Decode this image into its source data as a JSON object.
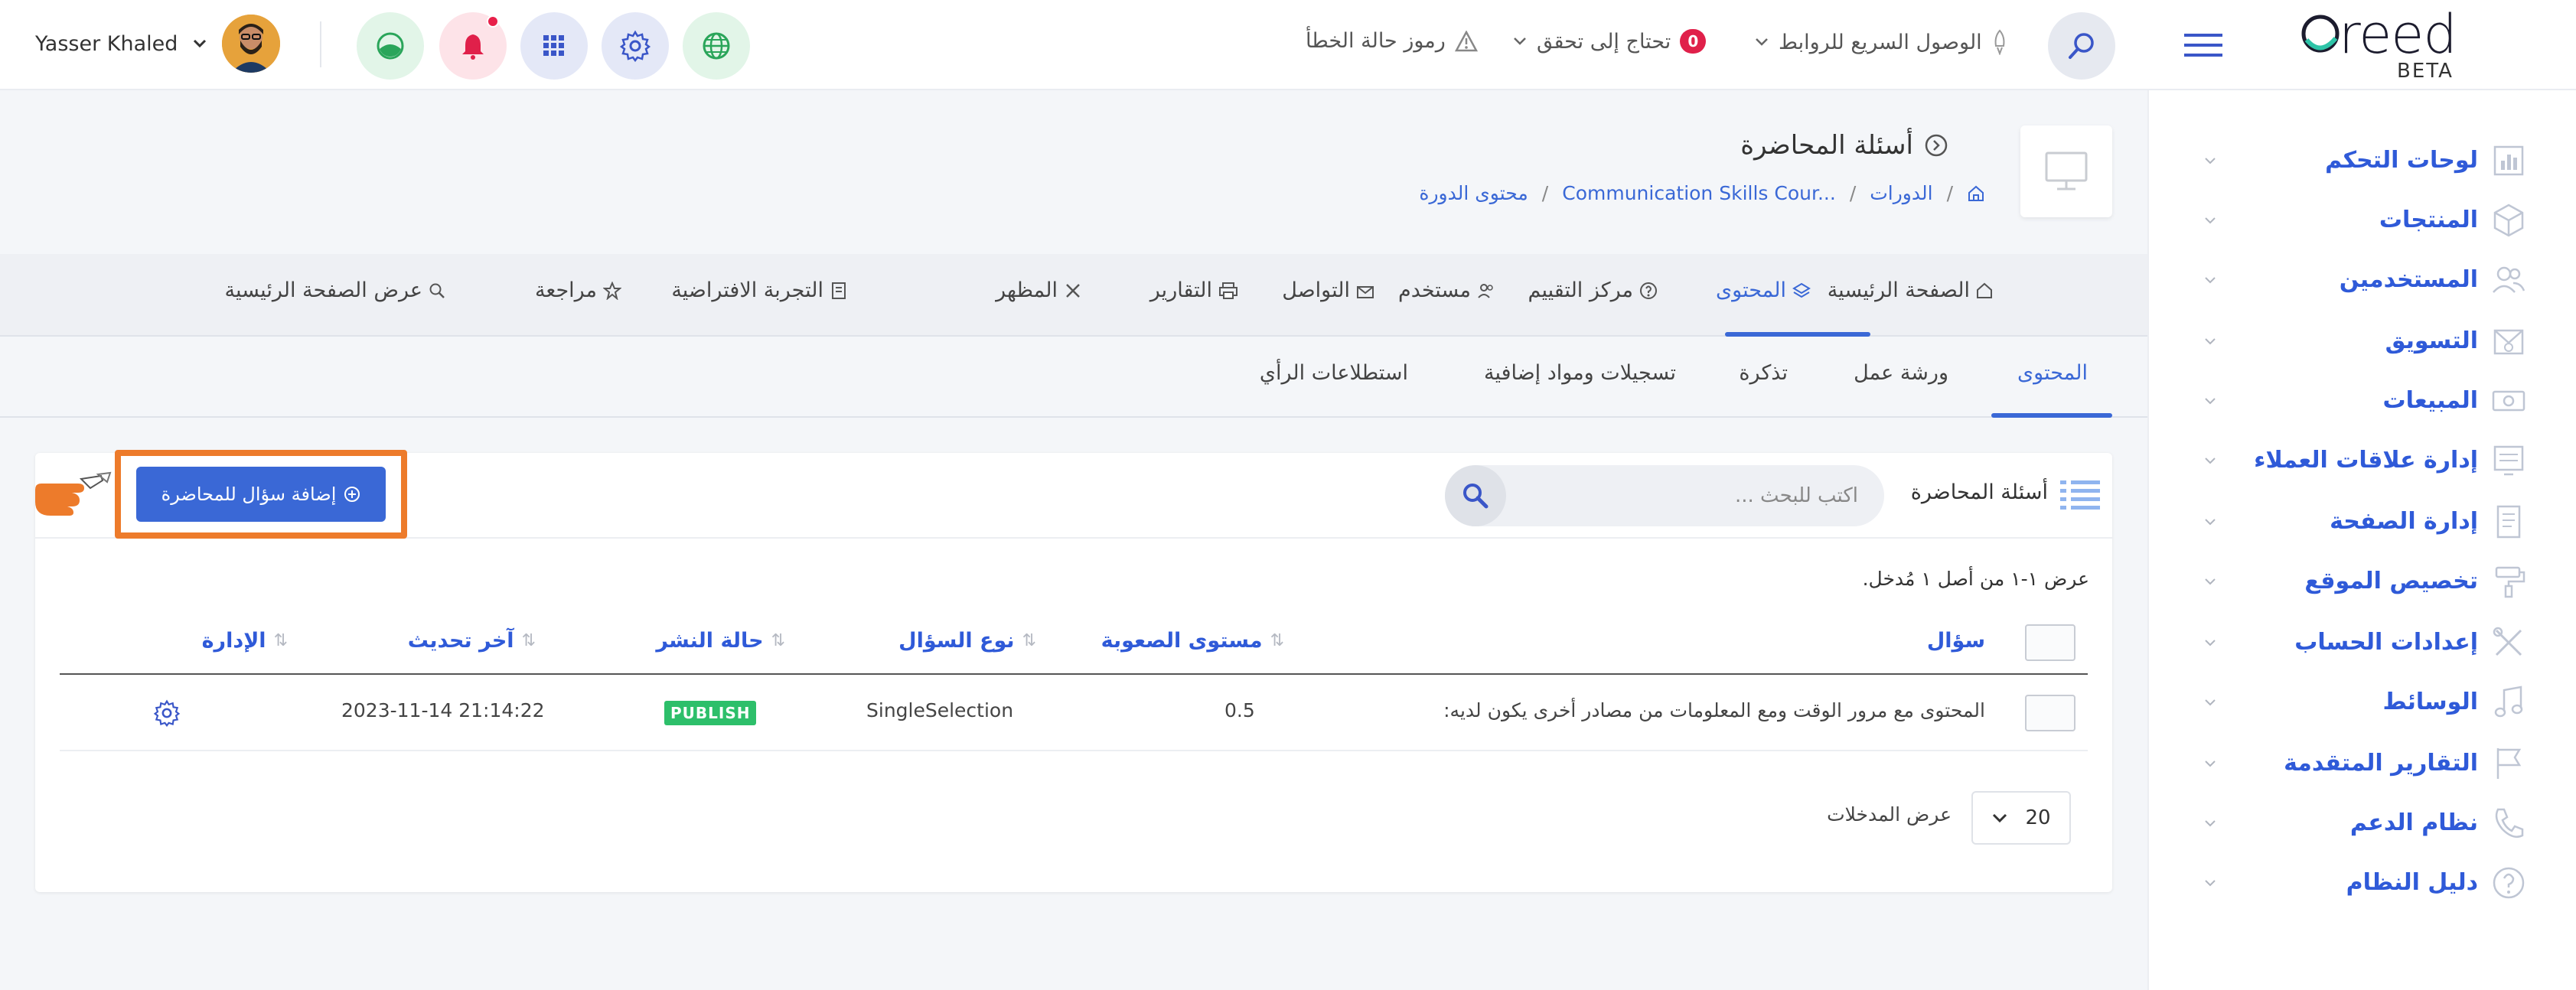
{
  "topbar": {
    "user_name": "Yasser Khaled",
    "quick_links_label": "الوصول السريع للروابط",
    "needs_check_label": "تحتاج إلى تحقق",
    "needs_check_count": "0",
    "error_codes_label": "رموز حالة الخطأ",
    "logo_text": "reed",
    "logo_beta": "BETA"
  },
  "sidebar": {
    "items": [
      {
        "label": "لوحات التحكم",
        "icon": "bar-chart-icon"
      },
      {
        "label": "المنتجات",
        "icon": "box-icon"
      },
      {
        "label": "المستخدمين",
        "icon": "users-icon"
      },
      {
        "label": "التسويق",
        "icon": "megaphone-icon"
      },
      {
        "label": "المبيعات",
        "icon": "cash-icon"
      },
      {
        "label": "إدارة علاقات العملاء",
        "icon": "crm-icon"
      },
      {
        "label": "إدارة الصفحة",
        "icon": "page-icon"
      },
      {
        "label": "تخصيص الموقع",
        "icon": "paint-roller-icon"
      },
      {
        "label": "إعدادات الحساب",
        "icon": "tools-icon"
      },
      {
        "label": "الوسائط",
        "icon": "music-icon"
      },
      {
        "label": "التقارير المتقدمة",
        "icon": "flag-icon"
      },
      {
        "label": "نظام الدعم",
        "icon": "phone-icon"
      },
      {
        "label": "دليل النظام",
        "icon": "help-icon"
      }
    ]
  },
  "header": {
    "title": "أسئلة المحاضرة",
    "breadcrumb": [
      "الدورات",
      "Communication Skills Cour...",
      "محتوى الدورة"
    ]
  },
  "main_tabs": [
    {
      "label": "الصفحة الرئيسية",
      "active": false
    },
    {
      "label": "المحتوى",
      "active": true
    },
    {
      "label": "مركز التقييم",
      "active": false
    },
    {
      "label": "مستخدم",
      "active": false
    },
    {
      "label": "التواصل",
      "active": false
    },
    {
      "label": "التقارير",
      "active": false
    },
    {
      "label": "المظهر",
      "active": false
    },
    {
      "label": "التجربة الافتراضية",
      "active": false
    },
    {
      "label": "مراجعة",
      "active": false
    },
    {
      "label": "عرض الصفحة الرئيسية",
      "active": false
    }
  ],
  "sub_tabs": [
    {
      "label": "المحتوى",
      "active": true
    },
    {
      "label": "ورشة عمل",
      "active": false
    },
    {
      "label": "تذكرة",
      "active": false
    },
    {
      "label": "تسجيلات ومواد إضافية",
      "active": false
    },
    {
      "label": "استطلاعات الرأي",
      "active": false
    }
  ],
  "card": {
    "title": "أسئلة المحاضرة",
    "search_placeholder": "اكتب للبحث ...",
    "add_button": "إضافة سؤال للمحاضرة",
    "info_text": "عرض ١-١ من أصل ١ مُدخل.",
    "columns": {
      "question": "سؤال",
      "difficulty": "مستوى الصعوبة",
      "type": "نوع السؤال",
      "status": "حالة النشر",
      "updated": "آخر تحديث",
      "manage": "الإدارة"
    },
    "rows": [
      {
        "question": "المحتوى مع مرور الوقت ومع المعلومات من مصادر أخرى يكون لديه:",
        "difficulty": "0.5",
        "type": "SingleSelection",
        "status": "PUBLISH",
        "updated": "2023-11-14 21:14:22"
      }
    ],
    "per_page_value": "20",
    "per_page_label": "عرض المدخلات"
  },
  "colors": {
    "accent": "#3a68d6",
    "highlight_frame": "#ed7b2b",
    "publish": "#2dbf6a",
    "badge": "#e0204a"
  }
}
